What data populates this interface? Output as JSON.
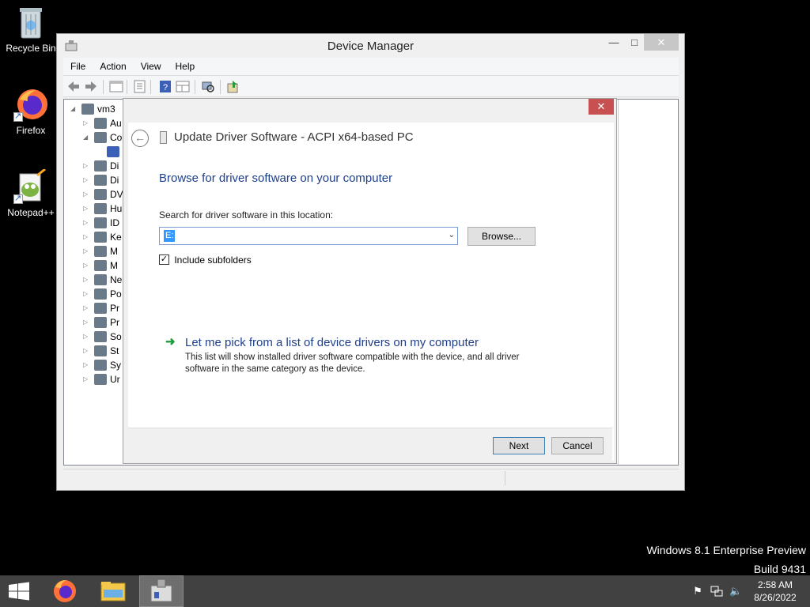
{
  "desktop": {
    "icons": [
      {
        "label": "Recycle Bin"
      },
      {
        "label": "Firefox"
      },
      {
        "label": "Notepad++"
      }
    ],
    "watermark_line1": "Windows 8.1 Enterprise Preview",
    "watermark_line2": "Build 9431"
  },
  "device_manager": {
    "title": "Device Manager",
    "menu": [
      "File",
      "Action",
      "View",
      "Help"
    ],
    "tree": [
      {
        "label": "vm3",
        "expander": "◢",
        "indent": 0
      },
      {
        "label": "Au",
        "expander": "▷",
        "indent": 1
      },
      {
        "label": "Co",
        "expander": "◢",
        "indent": 1
      },
      {
        "label": "",
        "expander": "",
        "indent": 2
      },
      {
        "label": "Di",
        "expander": "▷",
        "indent": 1
      },
      {
        "label": "Di",
        "expander": "▷",
        "indent": 1
      },
      {
        "label": "DV",
        "expander": "▷",
        "indent": 1
      },
      {
        "label": "Hu",
        "expander": "▷",
        "indent": 1
      },
      {
        "label": "ID",
        "expander": "▷",
        "indent": 1
      },
      {
        "label": "Ke",
        "expander": "▷",
        "indent": 1
      },
      {
        "label": "M",
        "expander": "▷",
        "indent": 1
      },
      {
        "label": "M",
        "expander": "▷",
        "indent": 1
      },
      {
        "label": "Ne",
        "expander": "▷",
        "indent": 1
      },
      {
        "label": "Po",
        "expander": "▷",
        "indent": 1
      },
      {
        "label": "Pr",
        "expander": "▷",
        "indent": 1
      },
      {
        "label": "Pr",
        "expander": "▷",
        "indent": 1
      },
      {
        "label": "So",
        "expander": "▷",
        "indent": 1
      },
      {
        "label": "St",
        "expander": "▷",
        "indent": 1
      },
      {
        "label": "Sy",
        "expander": "▷",
        "indent": 1
      },
      {
        "label": "Ur",
        "expander": "▷",
        "indent": 1
      }
    ]
  },
  "dialog": {
    "close_glyph": "✕",
    "header_title": "Update Driver Software - ACPI x64-based PC",
    "heading": "Browse for driver software on your computer",
    "search_label": "Search for driver software in this location:",
    "path_value": "E:",
    "browse_label": "Browse...",
    "include_subfolders_label": "Include subfolders",
    "include_subfolders_checked": true,
    "pick_title": "Let me pick from a list of device drivers on my computer",
    "pick_desc": "This list will show installed driver software compatible with the device, and all driver software in the same category as the device.",
    "next_label": "Next",
    "cancel_label": "Cancel"
  },
  "taskbar": {
    "time": "2:58 AM",
    "date": "8/26/2022"
  },
  "colors": {
    "accent_blue": "#1e3f8c",
    "close_red": "#c75050",
    "taskbar": "#414141"
  }
}
